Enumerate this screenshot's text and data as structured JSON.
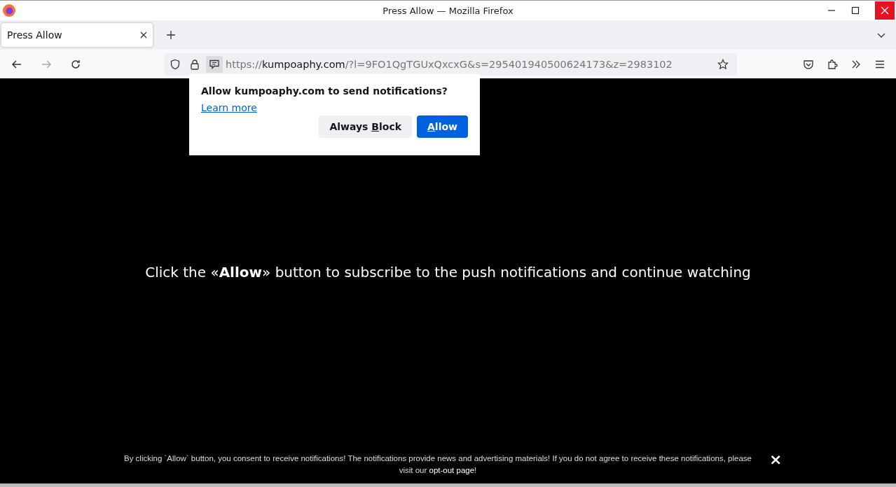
{
  "window": {
    "title": "Press Allow — Mozilla Firefox"
  },
  "tabs": [
    {
      "label": "Press Allow",
      "selected": true
    }
  ],
  "url": {
    "scheme": "https://",
    "host": "kumpoaphy.com",
    "rest": "/?l=9FO1QgTGUxQxcxG&s=295401940500624173&z=2983102"
  },
  "notification_popup": {
    "question": "Allow kumpoaphy.com to send notifications?",
    "link": "Learn more",
    "buttons": [
      {
        "label_before_key": "Always ",
        "access_key": "B",
        "label_after_key": "lock",
        "kind": "secondary"
      },
      {
        "access_key": "A",
        "label_after_key": "llow",
        "kind": "primary"
      }
    ]
  },
  "page": {
    "message": "Click the «**Allow**» button to subscribe to the push notifications and continue watching",
    "footer": {
      "text": "By clicking `Allow` button, you consent to receive notifications! The notifications provide news and advertising materials! If you do not agree to receive these notifications, please visit our",
      "link": "opt-out page",
      "after": "!",
      "close": "×"
    }
  }
}
